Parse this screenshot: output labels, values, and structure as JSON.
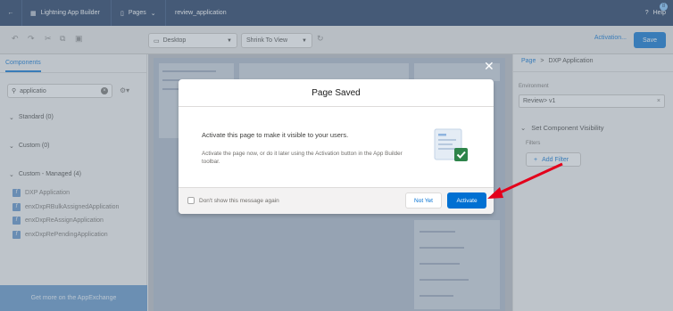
{
  "topbar": {
    "app_title": "Lightning App Builder",
    "pages_label": "Pages",
    "page_name": "review_application",
    "help_label": "Help",
    "help_badge": "8"
  },
  "toolbar": {
    "device": "Desktop",
    "zoom": "Shrink To View",
    "activation_label": "Activation...",
    "save_label": "Save"
  },
  "left_panel": {
    "tab": "Components",
    "search_value": "applicatio",
    "sections": [
      {
        "label": "Standard (0)"
      },
      {
        "label": "Custom (0)"
      },
      {
        "label": "Custom - Managed (4)"
      }
    ],
    "components": [
      "DXP Application",
      "enxDxpRBulkAssignedApplication",
      "enxDxpReAssignApplication",
      "enxDxpRePendingApplication"
    ],
    "appexchange_label": "Get more on the AppExchange"
  },
  "right_panel": {
    "crumb_root": "Page",
    "crumb_sep": ">",
    "crumb_current": "DXP Application",
    "env_label": "Environment",
    "env_value": "Review> v1",
    "visibility_header": "Set Component Visibility",
    "filters_label": "Filters",
    "add_filter_label": "Add Filter"
  },
  "modal": {
    "title": "Page Saved",
    "main_text": "Activate this page to make it visible to your users.",
    "sub_text": "Activate the page now, or do it later using the Activation button in the App Builder toolbar.",
    "checkbox_label": "Don't show this message again",
    "not_yet_label": "Not Yet",
    "activate_label": "Activate"
  },
  "colors": {
    "topbar": "#16325c",
    "brand_blue": "#0070d2",
    "success_green": "#2e844a",
    "annotation_arrow": "#e3001b"
  }
}
